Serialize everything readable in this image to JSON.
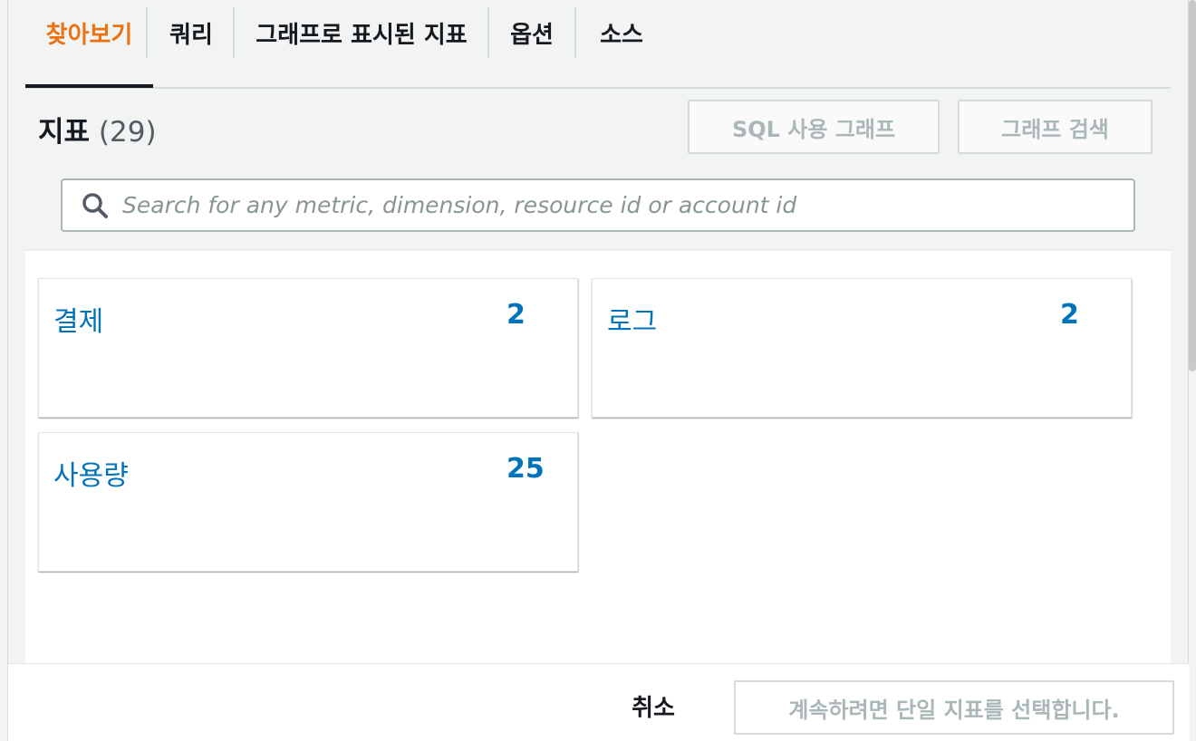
{
  "tabs": [
    {
      "label": "찾아보기",
      "active": true
    },
    {
      "label": "쿼리",
      "active": false
    },
    {
      "label": "그래프로 표시된 지표",
      "active": false
    },
    {
      "label": "옵션",
      "active": false
    },
    {
      "label": "소스",
      "active": false
    }
  ],
  "header": {
    "title": "지표",
    "count": "(29)",
    "sql_graph_button": "SQL 사용 그래프",
    "graph_search_button": "그래프 검색"
  },
  "search": {
    "placeholder": "Search for any metric, dimension, resource id or account id",
    "value": ""
  },
  "namespaces": [
    {
      "label": "결제",
      "count": "2"
    },
    {
      "label": "로그",
      "count": "2"
    },
    {
      "label": "사용량",
      "count": "25"
    }
  ],
  "footer": {
    "cancel_label": "취소",
    "continue_label": "계속하려면 단일 지표를 선택합니다."
  },
  "colors": {
    "accent": "#ec7211",
    "link": "#0073bb",
    "text": "#16191f",
    "disabled": "#aab7b8"
  }
}
